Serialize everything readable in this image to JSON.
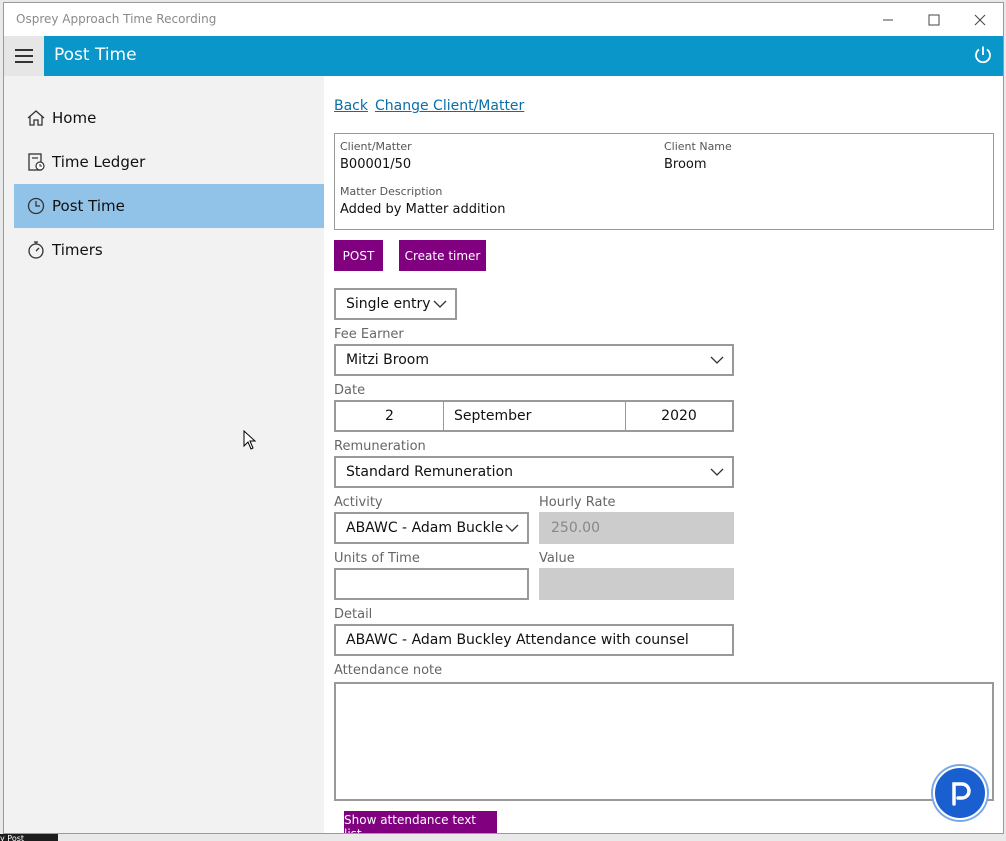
{
  "window": {
    "title": "Osprey Approach Time Recording"
  },
  "appbar": {
    "page_title": "Post Time"
  },
  "sidebar": {
    "items": [
      {
        "label": "Home",
        "icon": "home-icon"
      },
      {
        "label": "Time Ledger",
        "icon": "ledger-icon"
      },
      {
        "label": "Post Time",
        "icon": "clock-icon"
      },
      {
        "label": "Timers",
        "icon": "stopwatch-icon"
      }
    ]
  },
  "links": {
    "back": "Back",
    "change": "Change Client/Matter"
  },
  "info": {
    "client_matter_label": "Client/Matter",
    "client_matter_value": "B00001/50",
    "client_name_label": "Client Name",
    "client_name_value": "Broom",
    "matter_desc_label": "Matter Description",
    "matter_desc_value": "Added by Matter addition"
  },
  "buttons": {
    "post": "POST",
    "create_timer": "Create timer",
    "show_attendance": "Show attendance text list"
  },
  "form": {
    "entry_mode": "Single entry",
    "fee_earner_label": "Fee Earner",
    "fee_earner_value": "Mitzi Broom",
    "date_label": "Date",
    "date_day": "2",
    "date_month": "September",
    "date_year": "2020",
    "remuneration_label": "Remuneration",
    "remuneration_value": "Standard Remuneration",
    "activity_label": "Activity",
    "activity_value": "ABAWC - Adam Buckle",
    "hourly_rate_label": "Hourly Rate",
    "hourly_rate_value": "250.00",
    "units_label": "Units of Time",
    "units_value": "",
    "value_label": "Value",
    "value_value": "",
    "detail_label": "Detail",
    "detail_value": "ABAWC - Adam Buckley Attendance with counsel",
    "attendance_label": "Attendance note",
    "attendance_value": ""
  },
  "taskbar_fragment": "y Post",
  "colors": {
    "accent": "#0a96c8",
    "button": "#800080",
    "nav_active": "#91c3e8"
  }
}
